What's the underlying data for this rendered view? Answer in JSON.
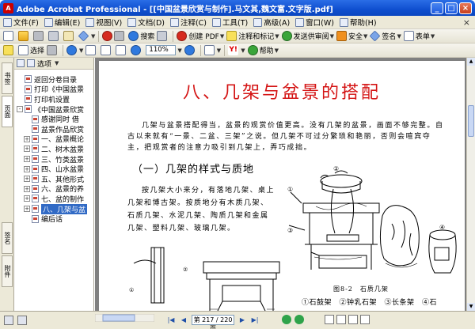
{
  "window": {
    "title": "Adobe Acrobat Professional - [[中国盆景欣赏与制作].马文其,魏文富.文字版.pdf]",
    "icon": "acrobat-icon",
    "controls": [
      "_",
      "□",
      "×"
    ]
  },
  "menu": {
    "items": [
      "文件(F)",
      "编辑(E)",
      "视图(V)",
      "文档(D)",
      "注释(C)",
      "工具(T)",
      "高级(A)",
      "窗口(W)",
      "帮助(H)"
    ],
    "close": "×"
  },
  "toolbar1": {
    "search_label": "搜索",
    "create_pdf_label": "创建 PDF",
    "comment_label": "注释和标记",
    "send_review_label": "发送供审阅",
    "security_label": "安全",
    "sign_label": "签名",
    "form_label": "表单"
  },
  "toolbar2": {
    "select_label": "选择",
    "zoom_value": "110%",
    "help_label": "帮助"
  },
  "nav_tabs": [
    "书签",
    "页面",
    "签名",
    "附件"
  ],
  "bookmarks_panel": {
    "options_label": "选项",
    "items": [
      {
        "label": "返回分卷目录",
        "level": 0,
        "expander": "",
        "selected": false
      },
      {
        "label": "打印《中国盆景",
        "level": 0,
        "expander": "",
        "selected": false
      },
      {
        "label": "打印机设置",
        "level": 0,
        "expander": "",
        "selected": false
      },
      {
        "label": "《中国盆景欣赏",
        "level": 0,
        "expander": "-",
        "selected": false
      },
      {
        "label": "感谢同时 借",
        "level": 1,
        "expander": "",
        "selected": false
      },
      {
        "label": "盆景作品欣赏",
        "level": 1,
        "expander": "",
        "selected": false
      },
      {
        "label": "一、盆景概论",
        "level": 1,
        "expander": "+",
        "selected": false
      },
      {
        "label": "二、树木盆景",
        "level": 1,
        "expander": "+",
        "selected": false
      },
      {
        "label": "三、竹类盆景",
        "level": 1,
        "expander": "+",
        "selected": false
      },
      {
        "label": "四、山水盆景",
        "level": 1,
        "expander": "+",
        "selected": false
      },
      {
        "label": "五、其他形式",
        "level": 1,
        "expander": "+",
        "selected": false
      },
      {
        "label": "六、盆景的养",
        "level": 1,
        "expander": "+",
        "selected": false
      },
      {
        "label": "七、盆的制作",
        "level": 1,
        "expander": "+",
        "selected": false
      },
      {
        "label": "八、几架与盆",
        "level": 1,
        "expander": "+",
        "selected": true
      },
      {
        "label": "编后话",
        "level": 1,
        "expander": "",
        "selected": false
      }
    ]
  },
  "document": {
    "title": "八、几架与盆景的搭配",
    "paragraph1": "几架与盆景搭配得当，盆景的观赏价值更高。没有几架的盆景，画面不够完整。自古以来就有“一景、二盆、三架”之说。但几架不可过分繁琐和艳丽，否则会喧宾夺主，把观赏者的注意力吸引到几架上，弄巧成拙。",
    "section_heading": "（一）几架的样式与质地",
    "paragraph2": "按几架大小来分，有落地几架、桌上几架和博古架。按质地分有木质几架、石质几架、水泥几架、陶质几架和金属几架、塑料几架、玻璃几架。",
    "figure_caption": "图8-2　石质几架",
    "figure_legend": "①石鼓架　②钟乳石架　③长条架　④石",
    "figure_markers": [
      "①",
      "②",
      "③",
      "④"
    ]
  },
  "status": {
    "page_display": "第 217 / 220 页",
    "nav_first": "|◀",
    "nav_prev": "◀",
    "nav_next": "▶",
    "nav_last": "▶|"
  },
  "colors": {
    "title_red": "#d41414",
    "selection_blue": "#316ac5",
    "titlebar_blue": "#0f4fcf",
    "chrome": "#ece9d8",
    "doc_background": "#808080"
  }
}
